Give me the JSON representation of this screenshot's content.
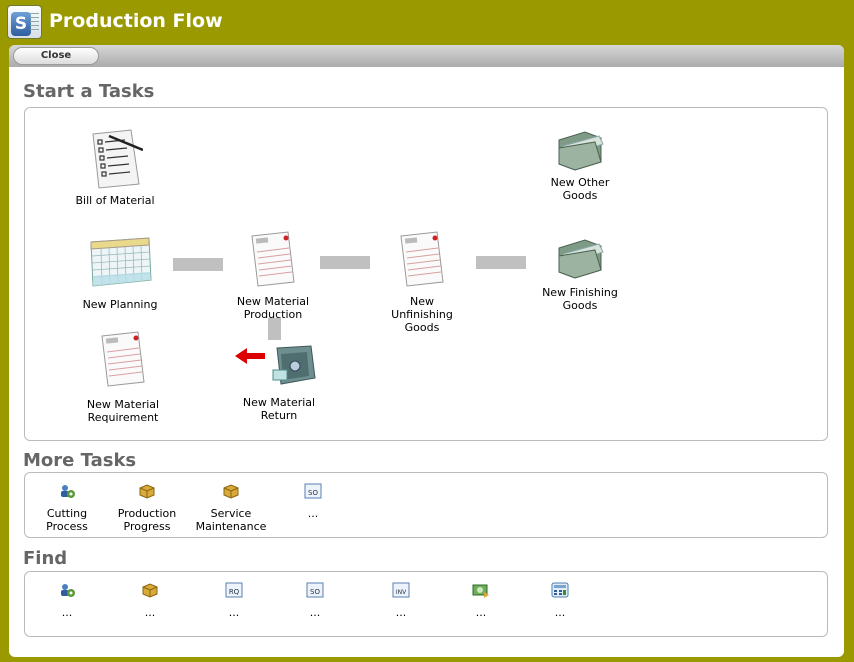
{
  "window": {
    "title": "Production Flow"
  },
  "toolbar": {
    "close_label": "Close"
  },
  "start_tasks": {
    "title": "Start a Tasks",
    "items": [
      {
        "label_1": "Bill of Material",
        "label_2": "",
        "icon": "checklist-icon"
      },
      {
        "label_1": "New Other",
        "label_2": "Goods",
        "icon": "folder-icon"
      },
      {
        "label_1": "New Planning",
        "label_2": "",
        "icon": "calendar-icon"
      },
      {
        "label_1": "New Material",
        "label_2": "Production",
        "icon": "report-icon"
      },
      {
        "label_1": "New Unfinishing",
        "label_2": "Goods",
        "icon": "report-icon"
      },
      {
        "label_1": "New Finishing",
        "label_2": "Goods",
        "icon": "folder-icon"
      },
      {
        "label_1": "New Material",
        "label_2": "Requirement",
        "icon": "report-icon"
      },
      {
        "label_1": "New Material",
        "label_2": "Return",
        "icon": "safe-return-icon"
      }
    ]
  },
  "more_tasks": {
    "title": "More Tasks",
    "items": [
      {
        "label_1": "Cutting",
        "label_2": "Process",
        "icon": "people-gear-icon"
      },
      {
        "label_1": "Production",
        "label_2": "Progress",
        "icon": "box-icon"
      },
      {
        "label_1": "Service",
        "label_2": "Maintenance",
        "icon": "box-icon"
      },
      {
        "label_1": "...",
        "label_2": "",
        "icon": "document-so-icon"
      }
    ]
  },
  "find": {
    "title": "Find",
    "items": [
      {
        "label": "...",
        "icon": "people-gear-icon"
      },
      {
        "label": "...",
        "icon": "box-icon"
      },
      {
        "label": "...",
        "icon": "document-rq-icon"
      },
      {
        "label": "...",
        "icon": "document-so-icon"
      },
      {
        "label": "...",
        "icon": "document-inv-icon"
      },
      {
        "label": "...",
        "icon": "money-transfer-icon"
      },
      {
        "label": "...",
        "icon": "calculator-icon"
      }
    ]
  },
  "colors": {
    "frame": "#9a9a00",
    "section_title": "#666666",
    "connector": "#c0c0c0",
    "arrow": "#dd0000"
  }
}
